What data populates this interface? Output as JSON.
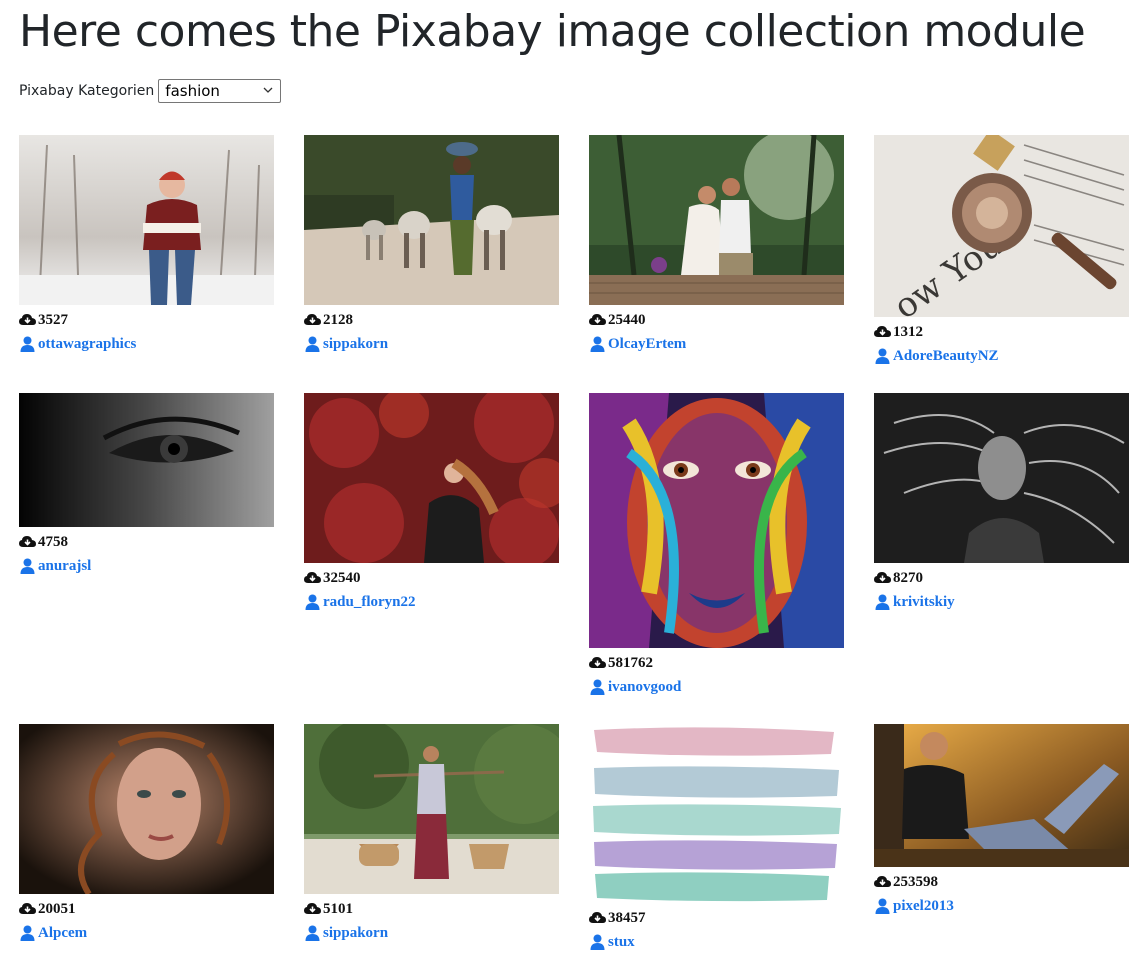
{
  "page": {
    "title": "Here comes the Pixabay image collection module"
  },
  "category": {
    "label": "Pixabay Kategorien",
    "selected": "fashion"
  },
  "colors": {
    "link": "#1a73e8",
    "text": "#212529"
  },
  "images": [
    {
      "downloads": "3527",
      "user": "ottawagraphics",
      "subject": "woman in red beanie and striped sweater in snowy park"
    },
    {
      "downloads": "2128",
      "user": "sippakorn",
      "subject": "woman with basket walking cows on dusty road"
    },
    {
      "downloads": "25440",
      "user": "OlcayErtem",
      "subject": "couple sitting on wooden pier in forest"
    },
    {
      "downloads": "1312",
      "user": "AdoreBeautyNZ",
      "subject": "compact powder and lipstick on newspaper"
    },
    {
      "downloads": "4758",
      "user": "anurajsl",
      "subject": "black and white close-up of eye"
    },
    {
      "downloads": "32540",
      "user": "radu_floryn22",
      "subject": "woman with flowing hair among red foliage"
    },
    {
      "downloads": "581762",
      "user": "ivanovgood",
      "subject": "face covered in colorful paint"
    },
    {
      "downloads": "8270",
      "user": "krivitskiy",
      "subject": "black and white woman with windblown hair"
    },
    {
      "downloads": "20051",
      "user": "Alpcem",
      "subject": "portrait of woman with curly hair"
    },
    {
      "downloads": "5101",
      "user": "sippakorn",
      "subject": "woman carrying baskets on shoulder pole"
    },
    {
      "downloads": "38457",
      "user": "stux",
      "subject": "pastel watercolor brush strokes"
    },
    {
      "downloads": "253598",
      "user": "pixel2013",
      "subject": "man relaxing against tree at sunset"
    }
  ]
}
